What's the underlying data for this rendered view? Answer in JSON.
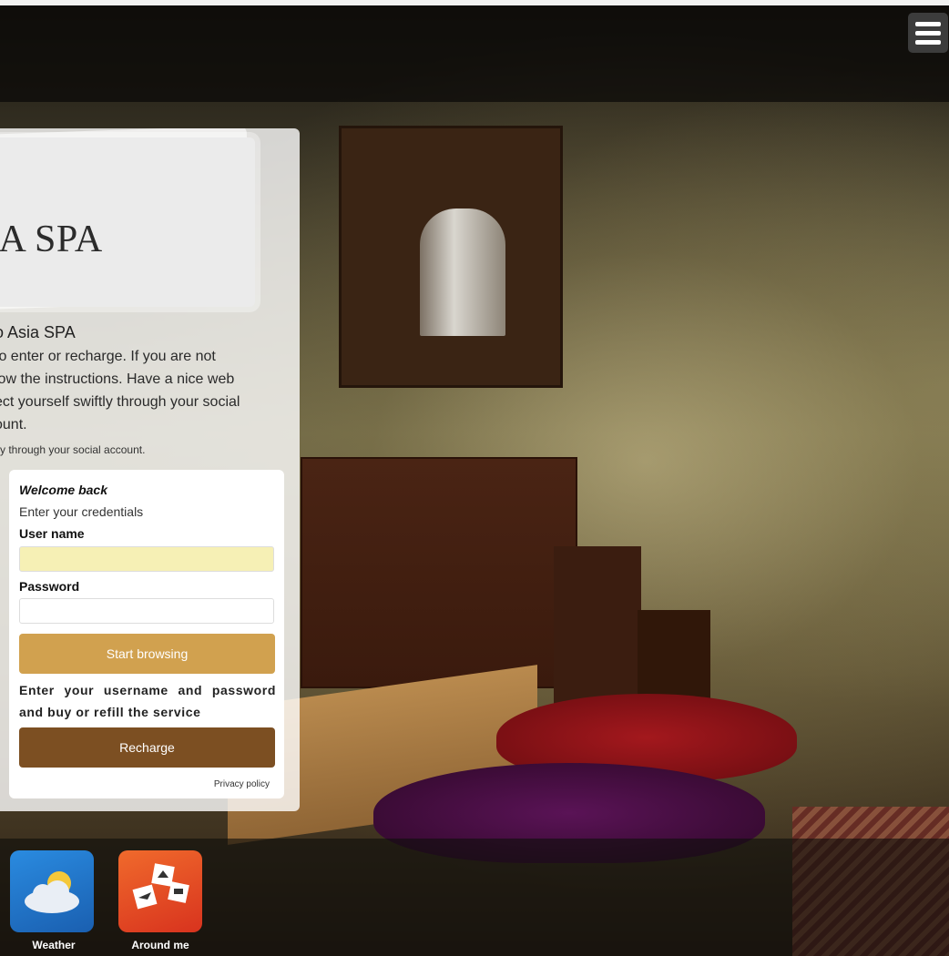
{
  "header": {
    "menu_icon": "hamburger-menu-icon"
  },
  "brand": {
    "logo_text": "IA SPA"
  },
  "intro": {
    "title": "o Asia SPA",
    "body": "to enter or recharge. If you are not low the instructions. Have a nice web ect yourself swiftly through your social ount.",
    "body_lines": [
      "to enter or recharge. If you are not",
      "low the instructions. Have a nice web",
      "ect yourself swiftly through your social",
      "ount."
    ],
    "social_line": "tly through your social account."
  },
  "login": {
    "heading": "Welcome back",
    "subheading": "Enter your credentials",
    "username_label": "User name",
    "username_value": "",
    "password_label": "Password",
    "password_value": "",
    "start_button": "Start browsing",
    "info_text": "Enter your username and password and buy or refill the service",
    "recharge_button": "Recharge",
    "privacy_link": "Privacy policy"
  },
  "apps": [
    {
      "label": "Weather",
      "icon": "weather-icon"
    },
    {
      "label": "Around me",
      "icon": "around-me-icon"
    }
  ],
  "colors": {
    "start_button": "#d1a14f",
    "recharge_button": "#7c4f22",
    "username_field": "#f6f0b5",
    "weather_tile": "#1e73c8",
    "around_me_tile": "#e5462a"
  }
}
